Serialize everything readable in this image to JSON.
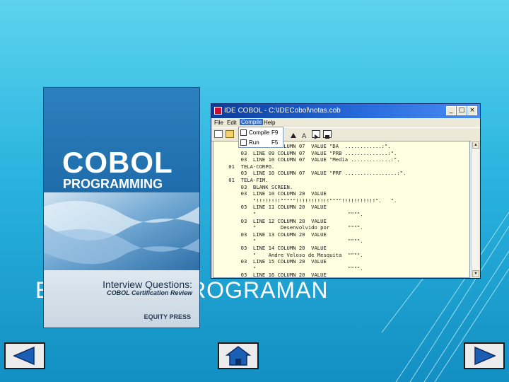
{
  "slide": {
    "title": "EVOLUÇÃO PROGRAMAN"
  },
  "book": {
    "title_main": "COBOL",
    "title_sub": "PROGRAMMING",
    "subtitle": "Interview Questions:",
    "tagline": "COBOL Certification Review",
    "publisher": "EQUITY PRESS"
  },
  "ide": {
    "title": "IDE COBOL - C:\\IDECobol\\notas.cob",
    "menu": [
      "File",
      "Edit",
      "Compile",
      "Help"
    ],
    "active_menu": "Compile",
    "dropdown": [
      {
        "label": "Compile",
        "shortcut": "F9"
      },
      {
        "label": "Run",
        "shortcut": "F5"
      }
    ],
    "code_lines": [
      "        03  LINE 09 COLUMN 07  VALUE \"DA  ............:\".",
      "        03  LINE 09 COLUMN 07  VALUE \"PRB ..............:\".",
      "        03  LINE 10 COLUMN 07  VALUE \"Media .............:\".",
      "    01  TELA-CORPO.",
      "        03  LINE 10 COLUMN 07  VALUE \"PRF .................:\".",
      "    01  TELA-FIM.",
      "        03  BLANK SCREEN.",
      "        03  LINE 10 COLUMN 20  VALUE",
      "            \"!!!!!!!!\"\"\"\"\"!!!!!!!!!!!\"\"\"\"!!!!!!!!!!!\".   \".",
      "        03  LINE 11 COLUMN 20  VALUE",
      "            \"                              \"\"\"\".",
      "        03  LINE 12 COLUMN 20  VALUE",
      "            \"        Desenvolvido por      \"\"\"\".",
      "        03  LINE 13 COLUMN 20  VALUE",
      "            \"                              \"\"\"\".",
      "        03  LINE 14 COLUMN 20  VALUE",
      "            \"    Andre Veloso de Mesquita  \"\"\"\".",
      "        03  LINE 15 COLUMN 20  VALUE",
      "            \"                              \"\"\"\".",
      "        03  LINE 16 COLUMN 20  VALUE"
    ]
  },
  "nav": {
    "prev": "previous-slide",
    "home": "home",
    "next": "next-slide"
  },
  "colors": {
    "background_top": "#5dd3ee",
    "background_bottom": "#138fc3",
    "book_blue": "#1b6aa8",
    "editor_bg": "#ffffe1",
    "nav_arrow": "#1a5fb4"
  }
}
